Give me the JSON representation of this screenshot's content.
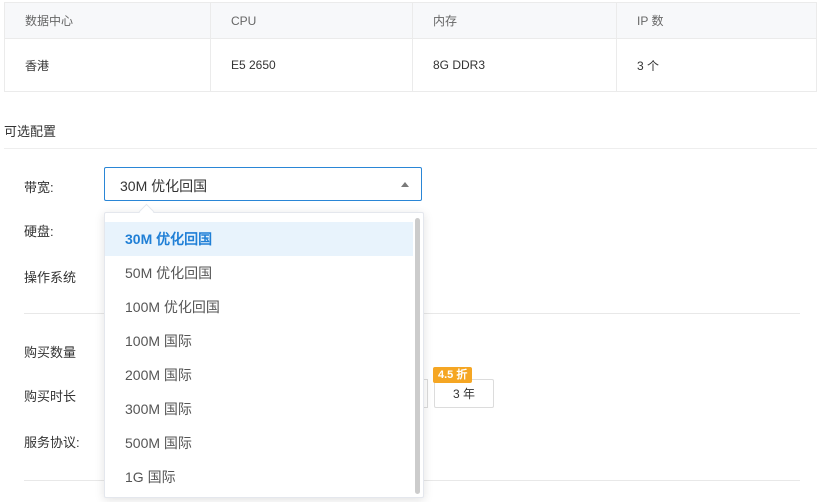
{
  "spec_table": {
    "headers": [
      "数据中心",
      "CPU",
      "内存",
      "IP 数"
    ],
    "row": [
      "香港",
      "E5 2650",
      "8G DDR3",
      "3 个"
    ]
  },
  "config": {
    "section_title": "可选配置",
    "bandwidth_label": "带宽:",
    "disk_label": "硬盘:",
    "os_label": "操作系统",
    "bandwidth_selected": "30M 优化回国",
    "options": [
      "30M 优化回国",
      "50M 优化回国",
      "100M 优化回国",
      "100M 国际",
      "200M 国际",
      "300M 国际",
      "500M 国际",
      "1G 国际"
    ]
  },
  "purchase": {
    "quantity_label": "购买数量",
    "duration_label": "购买时长",
    "agreement_label": "服务协议:",
    "duration_3y": "3 年",
    "discount_badge": "4.5 折"
  },
  "colors": {
    "accent": "#1f7fd6",
    "badge": "#f5a623"
  }
}
